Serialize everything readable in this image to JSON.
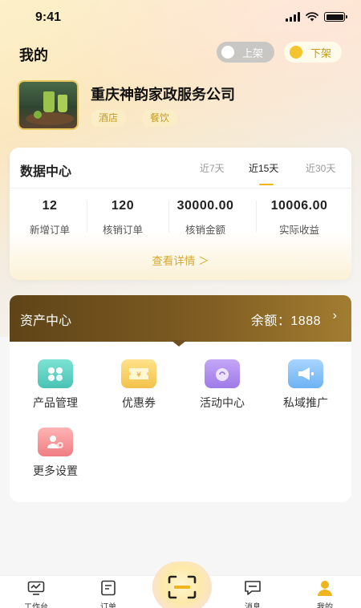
{
  "status_bar": {
    "time": "9:41"
  },
  "header": {
    "title": "我的",
    "toggle_on_label": "上架",
    "toggle_off_label": "下架"
  },
  "company": {
    "name": "重庆神韵家政服务公司",
    "tags": [
      "酒店",
      "餐饮"
    ]
  },
  "data_center": {
    "title": "数据中心",
    "ranges": [
      "近7天",
      "近15天",
      "近30天"
    ],
    "active_range": "近15天",
    "stats": [
      {
        "value": "12",
        "label": "新增订单"
      },
      {
        "value": "120",
        "label": "核销订单"
      },
      {
        "value": "30000.00",
        "label": "核销金额"
      },
      {
        "value": "10006.00",
        "label": "实际收益"
      }
    ],
    "detail_link": "查看详情 ＞"
  },
  "asset_center": {
    "title": "资产中心",
    "balance": "余额：1888",
    "chevron": "›"
  },
  "menu": [
    {
      "label": "产品管理",
      "icon": "product-grid-icon"
    },
    {
      "label": "优惠券",
      "icon": "coupon-icon"
    },
    {
      "label": "活动中心",
      "icon": "activity-icon"
    },
    {
      "label": "私域推广",
      "icon": "megaphone-icon"
    },
    {
      "label": "更多设置",
      "icon": "user-settings-icon"
    }
  ],
  "bottom_nav": [
    {
      "label": "工作台",
      "icon": "workbench-icon"
    },
    {
      "label": "订单",
      "icon": "order-icon"
    },
    {
      "label": "消息",
      "icon": "message-icon"
    },
    {
      "label": "我的",
      "icon": "profile-icon"
    }
  ],
  "colors": {
    "accent": "#f0b41f",
    "asset_bar_start": "#5f4418",
    "asset_bar_end": "#a27c30",
    "tag_bg": "#fbeec6",
    "tag_text": "#c99a1f"
  }
}
